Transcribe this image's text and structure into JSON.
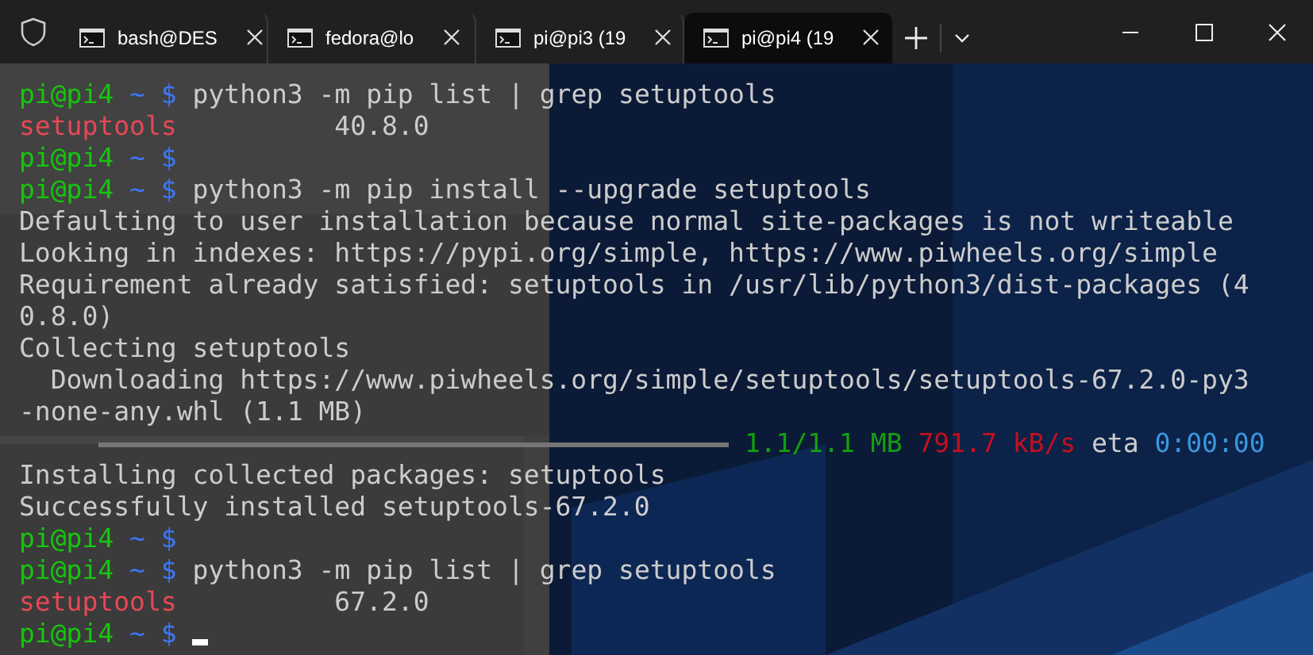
{
  "tabs": [
    {
      "title": "bash@DES",
      "selected": false
    },
    {
      "title": "fedora@lo",
      "selected": false
    },
    {
      "title": "pi@pi3 (19",
      "selected": false
    },
    {
      "title": "pi@pi4 (19",
      "selected": true
    }
  ],
  "terminal": {
    "lines": [
      {
        "kind": "prompt",
        "user": "pi@pi4",
        "path": "~",
        "symbol": "$",
        "command": "python3 -m pip list | grep setuptools"
      },
      {
        "kind": "package",
        "name": "setuptools",
        "version": "40.8.0"
      },
      {
        "kind": "prompt",
        "user": "pi@pi4",
        "path": "~",
        "symbol": "$"
      },
      {
        "kind": "prompt",
        "user": "pi@pi4",
        "path": "~",
        "symbol": "$",
        "command": "python3 -m pip install --upgrade setuptools"
      },
      {
        "kind": "output",
        "text": "Defaulting to user installation because normal site-packages is not writeable"
      },
      {
        "kind": "output",
        "text": "Looking in indexes: https://pypi.org/simple, https://www.piwheels.org/simple"
      },
      {
        "kind": "output",
        "text": "Requirement already satisfied: setuptools in /usr/lib/python3/dist-packages (4"
      },
      {
        "kind": "output",
        "text": "0.8.0)"
      },
      {
        "kind": "output",
        "text": "Collecting setuptools"
      },
      {
        "kind": "output",
        "text": "  Downloading https://www.piwheels.org/simple/setuptools/setuptools-67.2.0-py3"
      },
      {
        "kind": "output",
        "text": "-none-any.whl (1.1 MB)"
      },
      {
        "kind": "progress",
        "level": 1,
        "size": "1.1/1.1 MB",
        "speed": "791.7 kB/s",
        "eta_label": "eta",
        "eta": "0:00:00"
      },
      {
        "kind": "output",
        "text": "Installing collected packages: setuptools"
      },
      {
        "kind": "output",
        "text": "Successfully installed setuptools-67.2.0"
      },
      {
        "kind": "prompt",
        "user": "pi@pi4",
        "path": "~",
        "symbol": "$"
      },
      {
        "kind": "prompt",
        "user": "pi@pi4",
        "path": "~",
        "symbol": "$",
        "command": "python3 -m pip list | grep setuptools"
      },
      {
        "kind": "package",
        "name": "setuptools",
        "version": "67.2.0"
      },
      {
        "kind": "prompt",
        "user": "pi@pi4",
        "path": "~",
        "symbol": "$",
        "cursor": true
      }
    ]
  }
}
